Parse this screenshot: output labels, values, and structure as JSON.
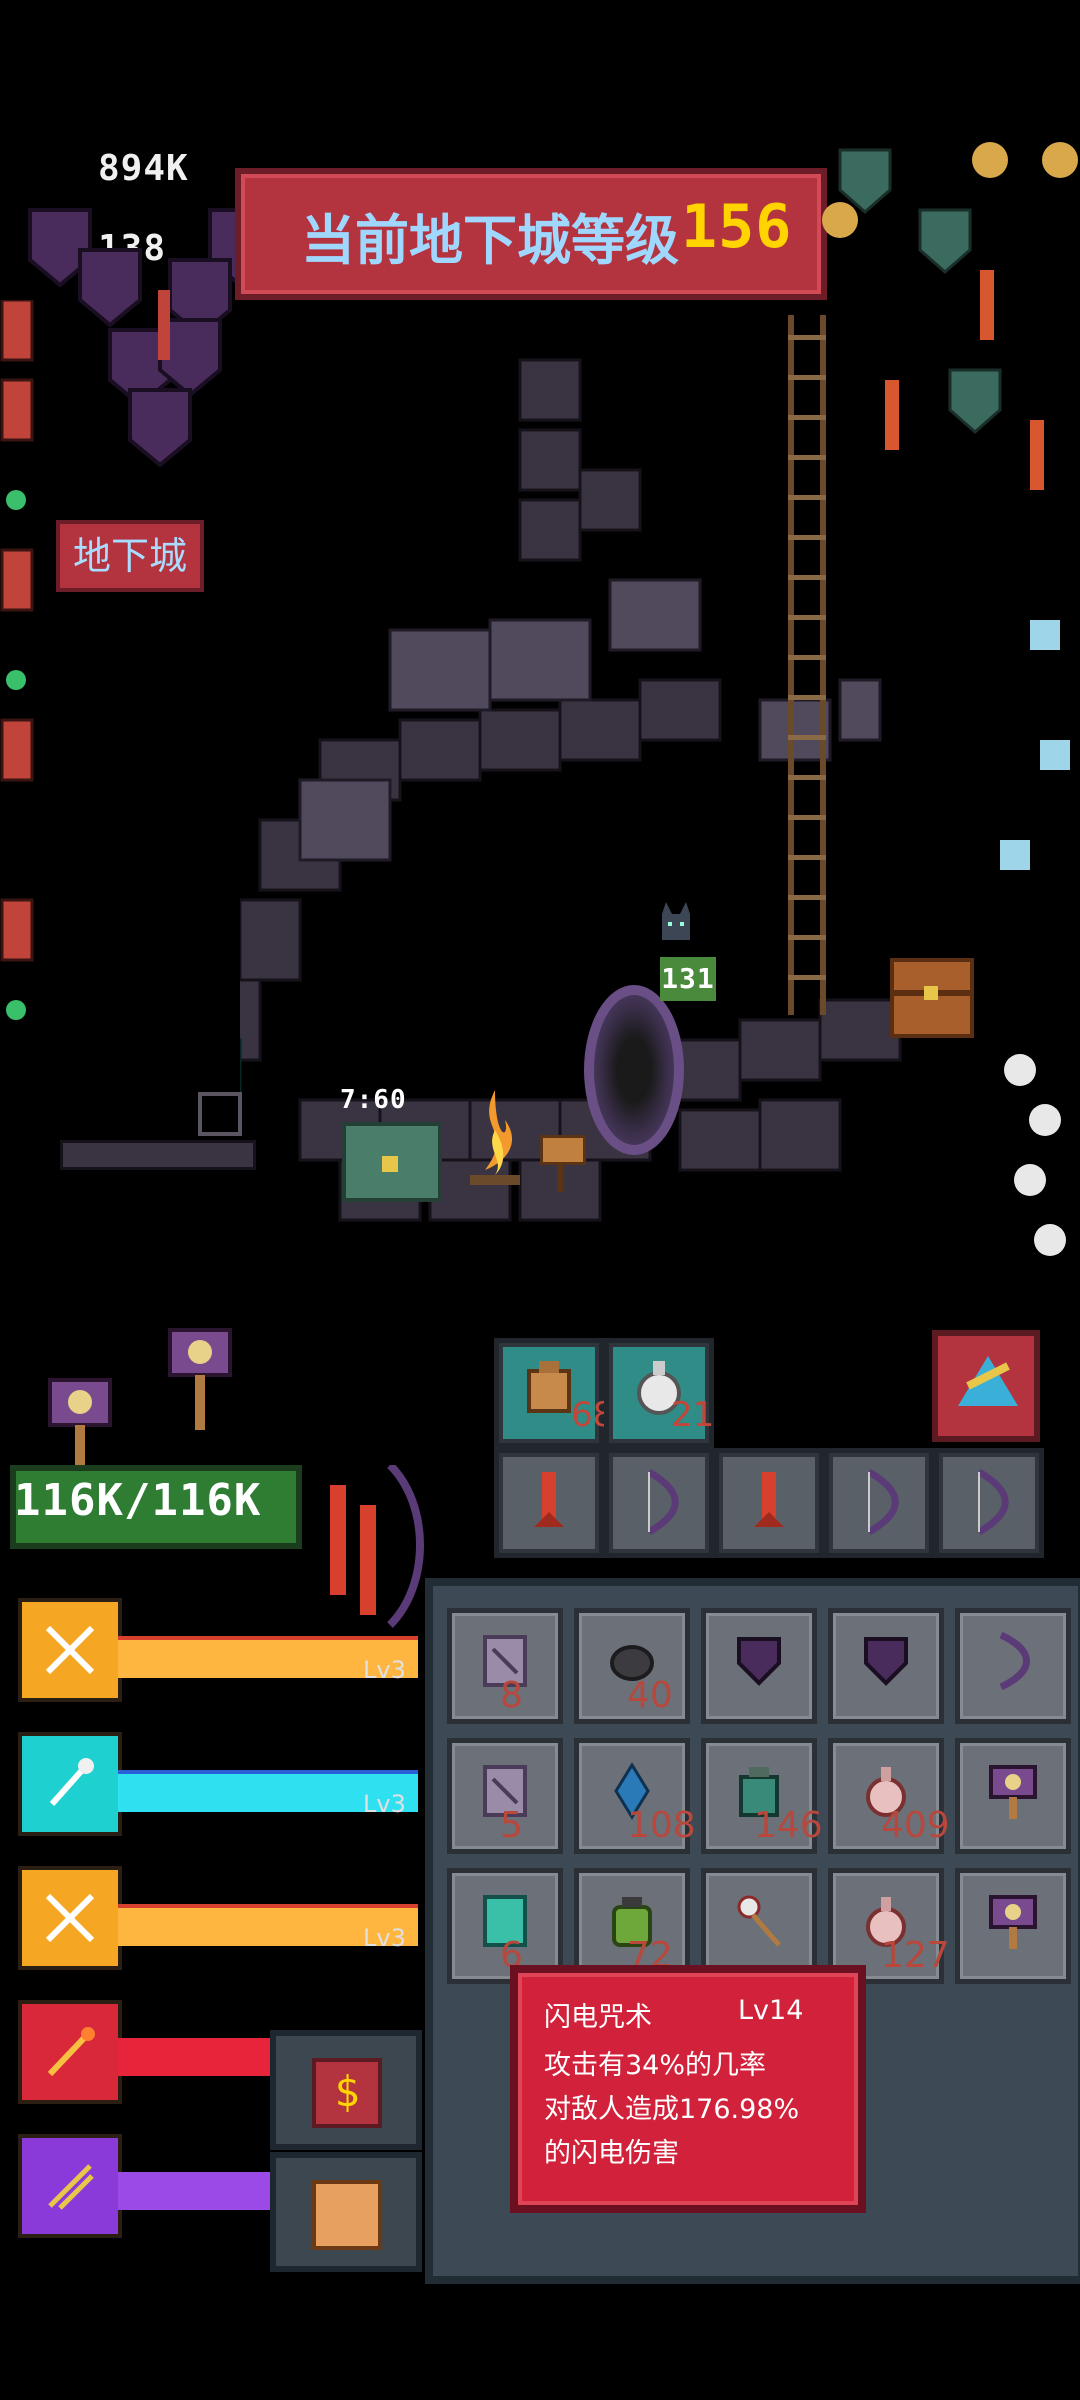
{
  "header": {
    "dungeon_level_label": "当前地下城等级",
    "dungeon_level_value": "156"
  },
  "stats": {
    "gold": "894K",
    "gems": "138"
  },
  "dungeon_button_label": "地下城",
  "scene": {
    "timer": "7:60",
    "player_level": "131"
  },
  "player": {
    "hp": "116K/116K"
  },
  "skills": [
    {
      "icon": "crossed-swords-icon",
      "level": "Lv3",
      "color": "#f5a623",
      "bar": "#ffb640"
    },
    {
      "icon": "magic-staff-icon",
      "level": "Lv3",
      "color": "#1fd0d0",
      "bar": "#2ee0f0"
    },
    {
      "icon": "crossed-swords-icon",
      "level": "Lv3",
      "color": "#f5a623",
      "bar": "#ffb640"
    },
    {
      "icon": "fire-wand-icon",
      "level": "",
      "color": "#d8283a",
      "bar": "#e8243a"
    },
    {
      "icon": "arrows-icon",
      "level": "",
      "color": "#8a3ad8",
      "bar": "#9b4ae8"
    }
  ],
  "consumables": [
    {
      "icon": "backpack-icon",
      "count": "68"
    },
    {
      "icon": "potion-flask-icon",
      "count": "21"
    }
  ],
  "equipment": [
    {
      "icon": "rocket-icon"
    },
    {
      "icon": "bow-icon"
    },
    {
      "icon": "rocket-icon"
    },
    {
      "icon": "bow-icon"
    },
    {
      "icon": "bow-icon"
    }
  ],
  "inventory": [
    {
      "icon": "spellbook-icon",
      "count": "8"
    },
    {
      "icon": "stone-icon",
      "count": "40"
    },
    {
      "icon": "shield-icon",
      "count": ""
    },
    {
      "icon": "shield-icon",
      "count": ""
    },
    {
      "icon": "bow-icon",
      "count": ""
    },
    {
      "icon": "spellbook-icon",
      "count": "5"
    },
    {
      "icon": "crystal-icon",
      "count": "108"
    },
    {
      "icon": "jar-icon",
      "count": "146"
    },
    {
      "icon": "potion-icon",
      "count": "409"
    },
    {
      "icon": "hammer-icon",
      "count": ""
    },
    {
      "icon": "scroll-icon",
      "count": "6"
    },
    {
      "icon": "green-jar-icon",
      "count": "72"
    },
    {
      "icon": "eye-staff-icon",
      "count": ""
    },
    {
      "icon": "potion-icon",
      "count": "127"
    },
    {
      "icon": "hammer-icon",
      "count": ""
    }
  ],
  "tooltip": {
    "name": "闪电咒术",
    "level": "Lv14",
    "line1": "攻击有34%的几率",
    "line2": "对敌人造成176.98%",
    "line3": "的闪电伤害"
  },
  "buttons": {
    "gold_symbol": "$"
  },
  "colors": {
    "banner": "#b3343f",
    "tooltip": "#d2213a",
    "hp": "#2f7d33"
  }
}
